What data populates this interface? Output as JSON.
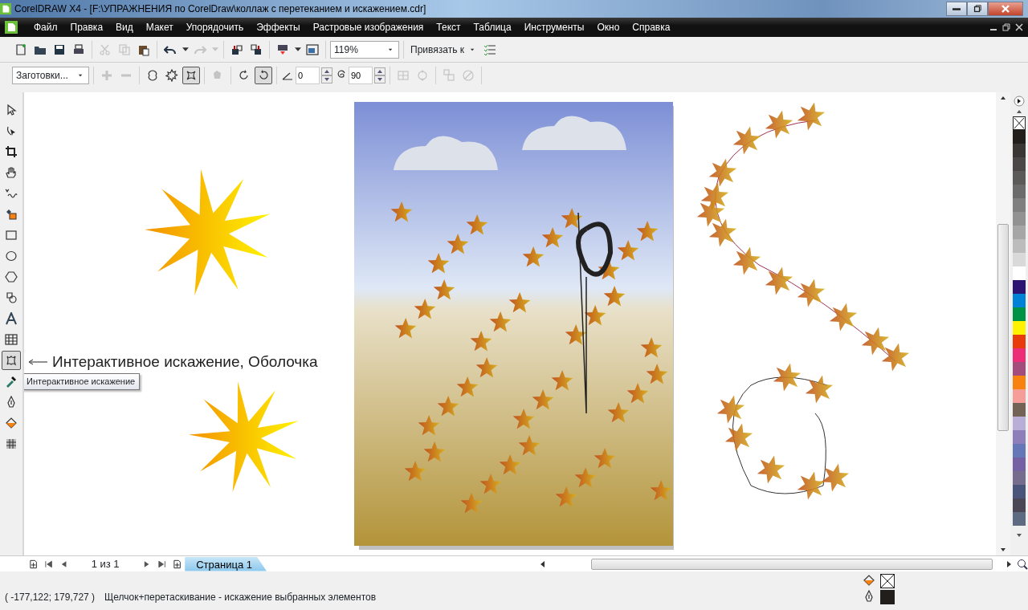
{
  "window": {
    "title": "CorelDRAW X4 - [F:\\УПРАЖНЕНИЯ по CorelDraw\\коллаж с перетеканием и искажением.cdr]"
  },
  "menu": [
    "Файл",
    "Правка",
    "Вид",
    "Макет",
    "Упорядочить",
    "Эффекты",
    "Растровые изображения",
    "Текст",
    "Таблица",
    "Инструменты",
    "Окно",
    "Справка"
  ],
  "standard_toolbar": {
    "groups": [
      [
        {
          "kind": "new",
          "disabled": false
        },
        {
          "kind": "open",
          "disabled": false
        },
        {
          "kind": "save",
          "disabled": false
        },
        {
          "kind": "print",
          "disabled": false
        }
      ],
      [
        {
          "kind": "cut",
          "disabled": true
        },
        {
          "kind": "copy",
          "disabled": true
        },
        {
          "kind": "paste",
          "disabled": false
        }
      ],
      [
        {
          "kind": "undo",
          "disabled": false
        },
        {
          "kind": "caret",
          "disabled": false
        },
        {
          "kind": "redo",
          "disabled": true
        },
        {
          "kind": "caret",
          "disabled": true
        }
      ],
      [
        {
          "kind": "import",
          "disabled": false
        },
        {
          "kind": "export",
          "disabled": false
        }
      ],
      [
        {
          "kind": "publish",
          "disabled": false
        },
        {
          "kind": "caret",
          "disabled": false
        },
        {
          "kind": "launcher",
          "disabled": false
        }
      ]
    ],
    "zoom": "119%",
    "snap": "Привязать к"
  },
  "property_bar": {
    "presets": "Заготовки...",
    "groups": [
      [
        {
          "kind": "plus",
          "disabled": true
        },
        {
          "kind": "minus",
          "disabled": true
        }
      ],
      [
        {
          "kind": "push-pull",
          "selected": false
        },
        {
          "kind": "zipper",
          "selected": false
        },
        {
          "kind": "twister",
          "selected": true
        }
      ],
      [
        {
          "kind": "copy-effect",
          "disabled": true
        }
      ],
      [
        {
          "kind": "clockwise",
          "selected": false
        },
        {
          "kind": "counterclockwise",
          "selected": true
        }
      ]
    ],
    "angle": "0",
    "rotations": "90",
    "after": [
      [
        {
          "kind": "center",
          "disabled": true
        },
        {
          "kind": "convert",
          "disabled": true
        }
      ],
      [
        {
          "kind": "copy-props",
          "disabled": true
        },
        {
          "kind": "clear",
          "disabled": true
        }
      ]
    ]
  },
  "toolbox": [
    {
      "kind": "pick",
      "selected": false
    },
    {
      "kind": "shape",
      "selected": false
    },
    {
      "kind": "crop",
      "selected": false
    },
    {
      "kind": "pan",
      "selected": false
    },
    {
      "kind": "freehand",
      "selected": false
    },
    {
      "kind": "smart-fill",
      "selected": false
    },
    {
      "kind": "rectangle",
      "selected": false
    },
    {
      "kind": "ellipse",
      "selected": false
    },
    {
      "kind": "polygon",
      "selected": false
    },
    {
      "kind": "basic-shapes",
      "selected": false
    },
    {
      "kind": "text",
      "selected": false
    },
    {
      "kind": "table",
      "selected": false
    },
    {
      "kind": "distort",
      "selected": true
    },
    {
      "kind": "eyedropper",
      "selected": false
    },
    {
      "kind": "outline",
      "selected": false
    },
    {
      "kind": "fill",
      "selected": false
    },
    {
      "kind": "mesh",
      "selected": false
    }
  ],
  "annotation": "Интерактивное искажение, Оболочка",
  "tooltip": "Интерактивное искажение",
  "page_bar": {
    "counter": "1 из 1",
    "tabs": [
      {
        "label": "Страница 1",
        "selected": true
      }
    ]
  },
  "palette": [
    {
      "color": "#211e1b"
    },
    {
      "color": "#3a3634"
    },
    {
      "color": "#4a4746"
    },
    {
      "color": "#5b5a59"
    },
    {
      "color": "#6b6b6b"
    },
    {
      "color": "#7f7f7f"
    },
    {
      "color": "#929292"
    },
    {
      "color": "#a6a6a6"
    },
    {
      "color": "#bcbcbc"
    },
    {
      "color": "#d9d9d9"
    },
    {
      "color": "#ffffff"
    },
    {
      "color": "#2e1472"
    },
    {
      "color": "#0083d7"
    },
    {
      "color": "#009245"
    },
    {
      "color": "#fff200"
    },
    {
      "color": "#e83c0c"
    },
    {
      "color": "#ec2e78"
    },
    {
      "color": "#a24d7c"
    },
    {
      "color": "#f7820f"
    },
    {
      "color": "#f59d98"
    },
    {
      "color": "#736357"
    },
    {
      "color": "#b8aed6"
    },
    {
      "color": "#8e7fbb"
    },
    {
      "color": "#6577b7"
    },
    {
      "color": "#7460a2"
    },
    {
      "color": "#756c8e"
    },
    {
      "color": "#4a5379"
    },
    {
      "color": "#4b4656"
    },
    {
      "color": "#5e6a82"
    }
  ],
  "status_bar": {
    "coordinates": "( -177,122; 179,727 )",
    "hint": "Щелчок+перетаскивание - искажение выбранных элементов",
    "fill": {
      "none": true
    },
    "outline": {
      "color": "#211e1b"
    }
  }
}
